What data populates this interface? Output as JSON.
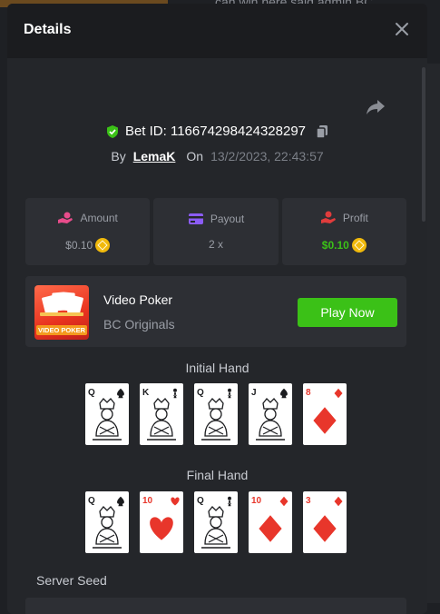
{
  "background": {
    "chat_snippet": "can win here said admin BC"
  },
  "modal": {
    "title": "Details",
    "bet": {
      "bet_id_label": "Bet ID: 116674298424328297",
      "by_label": "By",
      "user": "LemaK",
      "on_label": "On",
      "date": "13/2/2023, 22:43:57"
    },
    "stats": [
      {
        "label": "Amount",
        "value": "$0.10",
        "icon": "hand-coin-icon",
        "color": "#e84c8b"
      },
      {
        "label": "Payout",
        "value": "2 x",
        "icon": "wallet-icon",
        "color": "#8b5cf6"
      },
      {
        "label": "Profit",
        "value": "$0.10",
        "icon": "money-hand-icon",
        "color": "#e03c3c"
      }
    ],
    "game": {
      "name": "Video Poker",
      "provider": "BC Originals",
      "thumb_label": "VIDEO POKER",
      "play_label": "Play Now"
    },
    "initial_hand": {
      "title": "Initial Hand",
      "cards": [
        {
          "rank": "Q",
          "suit": "spade"
        },
        {
          "rank": "K",
          "suit": "club"
        },
        {
          "rank": "Q",
          "suit": "club"
        },
        {
          "rank": "J",
          "suit": "spade"
        },
        {
          "rank": "8",
          "suit": "diamond"
        }
      ]
    },
    "final_hand": {
      "title": "Final Hand",
      "cards": [
        {
          "rank": "Q",
          "suit": "spade"
        },
        {
          "rank": "10",
          "suit": "heart"
        },
        {
          "rank": "Q",
          "suit": "club"
        },
        {
          "rank": "10",
          "suit": "diamond"
        },
        {
          "rank": "3",
          "suit": "diamond"
        }
      ]
    },
    "server_seed_label": "Server Seed"
  },
  "colors": {
    "accent_green": "#3bc117",
    "red_suit": "#e8362b",
    "black_suit": "#1b1c1f",
    "coin": "#f0b90b"
  }
}
